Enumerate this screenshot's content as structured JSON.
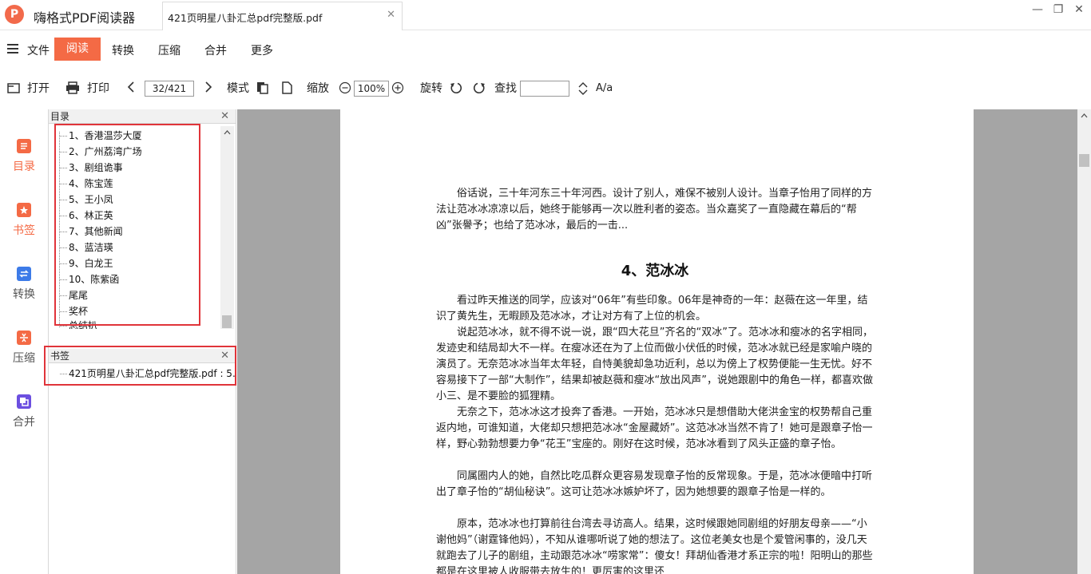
{
  "app": {
    "title": "嗨格式PDF阅读器",
    "logo_glyph": "P",
    "logo_color": "#f26a4b"
  },
  "tab": {
    "title": "421页明星八卦汇总pdf完整版.pdf",
    "close_glyph": "✕"
  },
  "window": {
    "minimize": "—",
    "restore": "❐",
    "close": "✕"
  },
  "menu": {
    "items": [
      "文件",
      "阅读",
      "转换",
      "压缩",
      "合并",
      "更多"
    ],
    "active": "阅读",
    "accent": "#f46a45"
  },
  "toolbar": {
    "open": "打开",
    "print": "打印",
    "page_value": "32/421",
    "mode": "模式",
    "zoom": "缩放",
    "zoom_value": "100%",
    "rotate": "旋转",
    "find": "查找",
    "find_value": "",
    "match_case": "A/a"
  },
  "leftnav": {
    "items": [
      {
        "label": "目录",
        "icon": "list-icon",
        "color": "#f46a45",
        "active": true
      },
      {
        "label": "书签",
        "icon": "bookmark-icon",
        "color": "#f46a45",
        "active": false
      },
      {
        "label": "转换",
        "icon": "convert-icon",
        "color": "#3d7be8",
        "active": false
      },
      {
        "label": "压缩",
        "icon": "compress-icon",
        "color": "#f46a45",
        "active": false
      },
      {
        "label": "合并",
        "icon": "merge-icon",
        "color": "#6c4fe0",
        "active": false
      }
    ]
  },
  "toc": {
    "title": "目录",
    "items": [
      "1、香港温莎大厦",
      "2、广州荔湾广场",
      "3、剧组诡事",
      "4、陈宝莲",
      "5、王小凤",
      "6、林正英",
      "7、其他新闻",
      "8、蓝洁瑛",
      "9、白龙王",
      "10、陈紫函",
      "尾尾",
      "奖杯",
      "总结扒"
    ]
  },
  "bookmarks": {
    "title": "书签",
    "items": [
      "421页明星八卦汇总pdf完整版.pdf : 5."
    ]
  },
  "document": {
    "intro": "俗话说，三十年河东三十年河西。设计了别人，难保不被别人设计。当章子怡用了同样的方法让范冰冰凉凉以后，她终于能够再一次以胜利者的姿态。当众嘉奖了一直隐藏在幕后的“帮凶”张譽予；也给了范冰冰，最后的一击...",
    "heading": "4、范冰冰",
    "paragraphs": [
      "看过昨天推送的同学，应该对“06年”有些印象。06年是神奇的一年：赵薇在这一年里，结识了黄先生，无暇顾及范冰冰，才让对方有了上位的机会。",
      "说起范冰冰，就不得不说一说，跟“四大花旦”齐名的“双冰”了。范冰冰和瘦冰的名字相同，发迹史和结局却大不一样。在瘦冰还在为了上位而做小伏低的时候，范冰冰就已经是家喻户晓的演员了。无奈范冰冰当年太年轻，自恃美貌却急功近利，总以为傍上了权势便能一生无忧。好不容易接下了一部“大制作”，结果却被赵薇和瘦冰“放出风声”，说她跟剧中的角色一样，都喜欢做小三、是不要脸的狐狸精。",
      "无奈之下，范冰冰这才投奔了香港。一开始，范冰冰只是想借助大佬洪金宝的权势帮自己重返内地，可谁知道，大佬却只想把范冰冰“金屋藏娇”。这范冰冰当然不肯了！她可是跟章子怡一样，野心勃勃想要力争“花王”宝座的。刚好在这时候，范冰冰看到了风头正盛的章子怡。",
      "同属圈内人的她，自然比吃瓜群众更容易发现章子怡的反常现象。于是，范冰冰便暗中打听出了章子怡的“胡仙秘诀”。这可让范冰冰嫉妒坏了，因为她想要的跟章子怡是一样的。",
      "原本，范冰冰也打算前往台湾去寻访高人。结果，这时候跟她同剧组的好朋友母亲——“小谢他妈”（谢霆锋他妈），不知从谁哪听说了她的想法了。这位老美女也是个爱管闲事的，没几天就跑去了儿子的剧组，主动跟范冰冰“唠家常”：傻女！拜胡仙香港才系正宗的啦！阳明山的那些都是在这里被人收服带去放生的！更厉害的这里还"
    ]
  }
}
